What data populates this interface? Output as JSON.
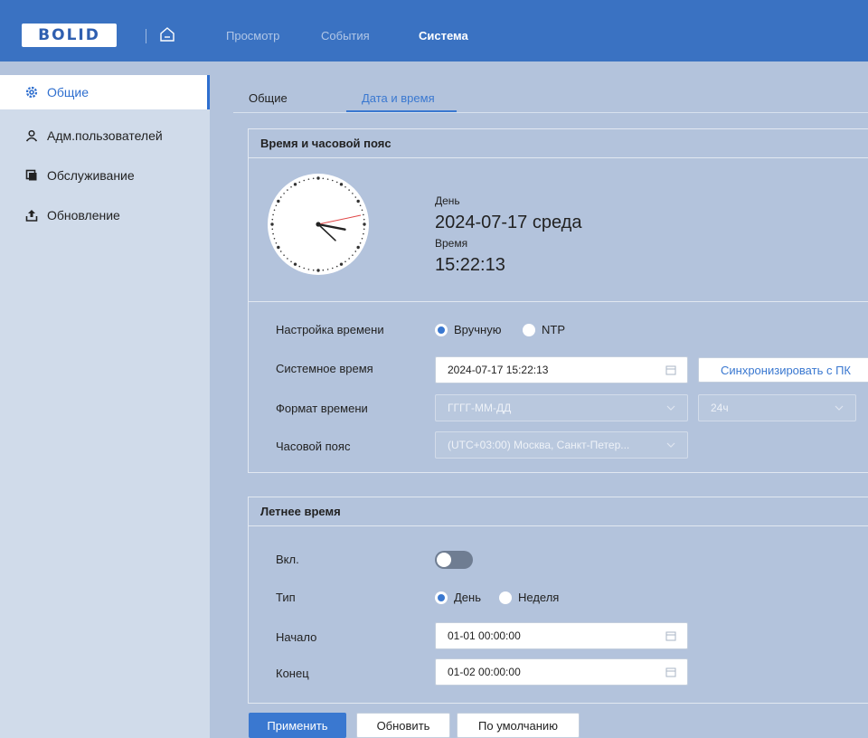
{
  "header": {
    "logo_text": "BOLID",
    "nav": [
      "Просмотр",
      "События",
      "Система"
    ],
    "active_nav": "Система"
  },
  "sidebar": {
    "items": [
      {
        "label": "Общие",
        "icon": "gear-icon",
        "active": true
      },
      {
        "label": "Адм.пользователей",
        "icon": "user-icon",
        "active": false
      },
      {
        "label": "Обслуживание",
        "icon": "copy-icon",
        "active": false
      },
      {
        "label": "Обновление",
        "icon": "upload-icon",
        "active": false
      }
    ]
  },
  "tabs": [
    {
      "label": "Общие",
      "active": false
    },
    {
      "label": "Дата и время",
      "active": true
    }
  ],
  "time_panel": {
    "title": "Время и часовой пояс",
    "day_label": "День",
    "date_value": "2024-07-17 среда",
    "time_label": "Время",
    "time_value": "15:22:13",
    "clock": {
      "hour": 15,
      "minute": 22,
      "second": 13
    },
    "setting_label": "Настройка времени",
    "mode_manual": "Вручную",
    "mode_ntp": "NTP",
    "system_time_label": "Системное время",
    "system_time_value": "2024-07-17 15:22:13",
    "sync_button": "Синхронизировать с ПК",
    "format_label": "Формат времени",
    "date_format_value": "ГГГГ-ММ-ДД",
    "hour_format_value": "24ч",
    "timezone_label": "Часовой пояс",
    "timezone_value": "(UTC+03:00) Москва, Санкт-Петер..."
  },
  "dst_panel": {
    "title": "Летнее время",
    "enable_label": "Вкл.",
    "enabled": false,
    "type_label": "Тип",
    "type_day": "День",
    "type_week": "Неделя",
    "start_label": "Начало",
    "start_value": "01-01 00:00:00",
    "end_label": "Конец",
    "end_value": "01-02 00:00:00"
  },
  "footer": {
    "apply": "Применить",
    "refresh": "Обновить",
    "default": "По умолчанию"
  },
  "colors": {
    "accent": "#3a78d0",
    "topbar": "#3a72c2",
    "background": "#b3c3dc"
  }
}
